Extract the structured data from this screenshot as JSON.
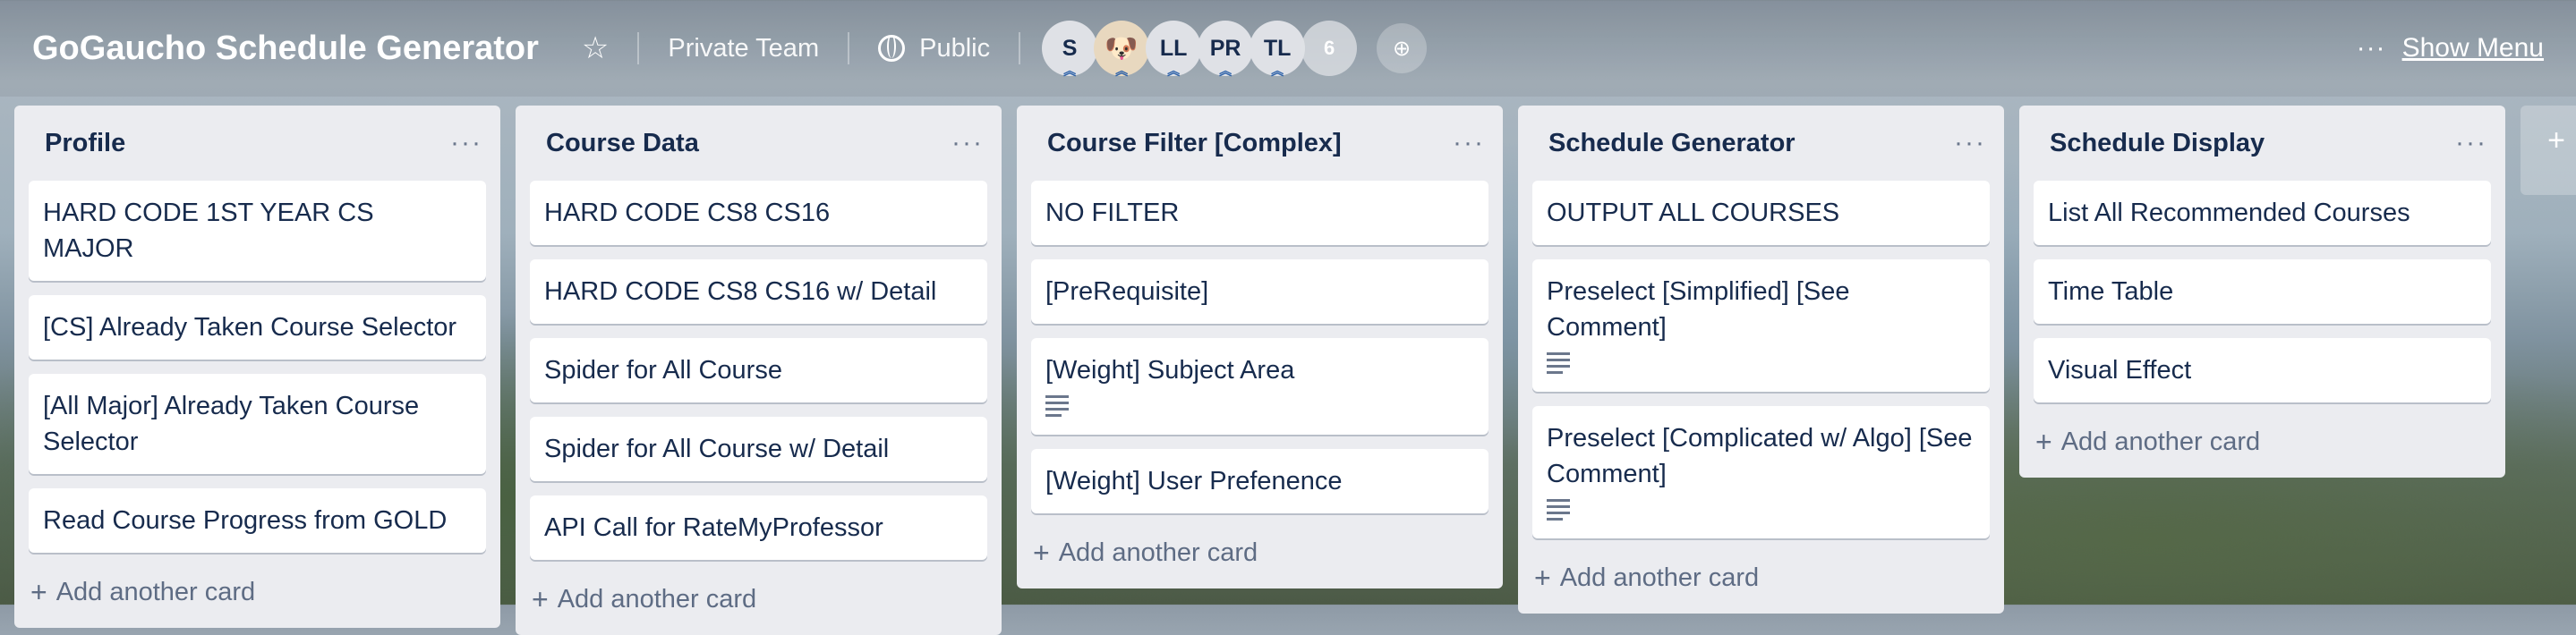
{
  "board": {
    "title": "GoGaucho Schedule Generator",
    "team": "Private Team",
    "visibility": "Public",
    "members": [
      {
        "initials": "S"
      },
      {
        "initials": "",
        "avatar": "dog-avatar"
      },
      {
        "initials": "LL"
      },
      {
        "initials": "PR"
      },
      {
        "initials": "TL"
      },
      {
        "initials": "6"
      }
    ],
    "show_menu": "Show Menu",
    "menu_dots": "···",
    "star_icon": "☆",
    "add_list_plus": "+"
  },
  "lists": [
    {
      "title": "Profile",
      "menu": "···",
      "cards": [
        {
          "text": "HARD CODE 1ST YEAR CS MAJOR"
        },
        {
          "text": "[CS] Already Taken Course Selector"
        },
        {
          "text": "[All Major] Already Taken Course Selector"
        },
        {
          "text": "Read Course Progress from GOLD"
        }
      ],
      "add": "Add another card"
    },
    {
      "title": "Course Data",
      "menu": "···",
      "cards": [
        {
          "text": "HARD CODE CS8 CS16"
        },
        {
          "text": "HARD CODE CS8 CS16 w/ Detail"
        },
        {
          "text": "Spider for All Course"
        },
        {
          "text": "Spider for All Course w/ Detail"
        },
        {
          "text": "API Call for RateMyProfessor"
        }
      ],
      "add": "Add another card"
    },
    {
      "title": "Course Filter [Complex]",
      "menu": "···",
      "cards": [
        {
          "text": "NO FILTER"
        },
        {
          "text": "[PreRequisite]"
        },
        {
          "text": "[Weight] Subject Area",
          "has_description": true
        },
        {
          "text": "[Weight] User Prefenence"
        }
      ],
      "add": "Add another card"
    },
    {
      "title": "Schedule Generator",
      "menu": "···",
      "cards": [
        {
          "text": "OUTPUT ALL COURSES"
        },
        {
          "text": "Preselect [Simplified] [See Comment]",
          "has_description": true
        },
        {
          "text": "Preselect [Complicated w/ Algo] [See Comment]",
          "has_description": true
        }
      ],
      "add": "Add another card"
    },
    {
      "title": "Schedule Display",
      "menu": "···",
      "cards": [
        {
          "text": "List All Recommended Courses"
        },
        {
          "text": "Time Table"
        },
        {
          "text": "Visual Effect"
        }
      ],
      "add": "Add another card"
    }
  ]
}
